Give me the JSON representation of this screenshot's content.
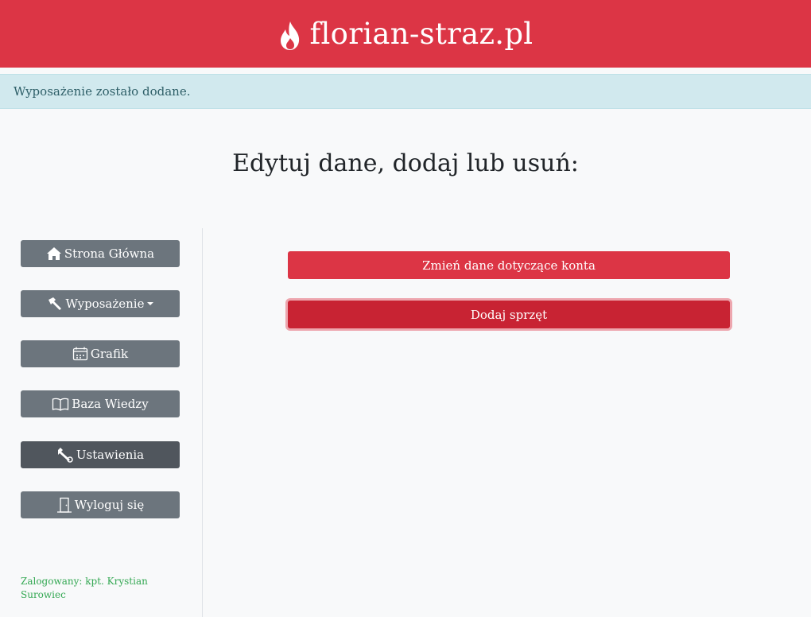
{
  "header": {
    "brand": "florian-straz.pl",
    "icon": "fire-icon"
  },
  "flash": {
    "message": "Wyposażenie zostało dodane."
  },
  "main": {
    "heading": "Edytuj dane, dodaj lub usuń:",
    "actions": [
      {
        "label": "Zmień dane dotyczące konta"
      },
      {
        "label": "Dodaj sprzęt"
      }
    ]
  },
  "sidebar": {
    "items": [
      {
        "label": "Strona Główna",
        "icon": "house-icon"
      },
      {
        "label": "Wyposażenie",
        "icon": "hammer-icon",
        "dropdown": true
      },
      {
        "label": "Grafik",
        "icon": "calendar-icon"
      },
      {
        "label": "Baza Wiedzy",
        "icon": "book-icon"
      },
      {
        "label": "Ustawienia",
        "icon": "wrench-icon",
        "active": true
      },
      {
        "label": "Wyloguj się",
        "icon": "door-icon"
      }
    ],
    "user": "Zalogowany: kpt. Krystian Surowiec"
  },
  "colors": {
    "brand": "#dc3545",
    "secondary": "#6c757d",
    "flash_bg": "#d1e9ee",
    "user_text": "#34a853"
  }
}
